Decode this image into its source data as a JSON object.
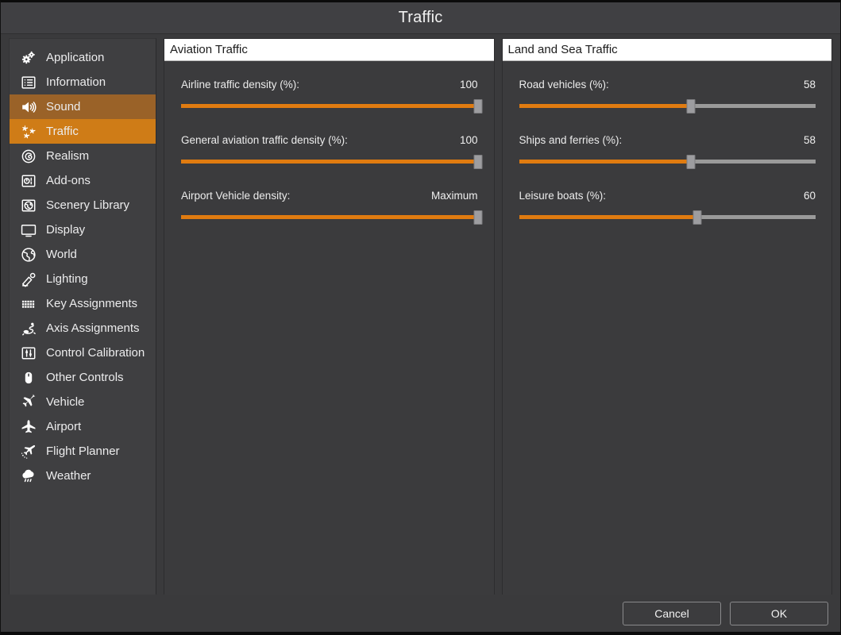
{
  "window": {
    "title": "Traffic"
  },
  "sidebar": {
    "items": [
      {
        "label": "Application",
        "icon": "gears-icon",
        "state": "normal"
      },
      {
        "label": "Information",
        "icon": "list-document-icon",
        "state": "normal"
      },
      {
        "label": "Sound",
        "icon": "speaker-icon",
        "state": "hovered"
      },
      {
        "label": "Traffic",
        "icon": "multiple-aircraft-icon",
        "state": "selected"
      },
      {
        "label": "Realism",
        "icon": "spiral-circle-icon",
        "state": "normal"
      },
      {
        "label": "Add-ons",
        "icon": "plugin-box-icon",
        "state": "normal"
      },
      {
        "label": "Scenery Library",
        "icon": "globe-square-icon",
        "state": "normal"
      },
      {
        "label": "Display",
        "icon": "monitor-icon",
        "state": "normal"
      },
      {
        "label": "World",
        "icon": "globe-icon",
        "state": "normal"
      },
      {
        "label": "Lighting",
        "icon": "lamp-icon",
        "state": "normal"
      },
      {
        "label": "Key Assignments",
        "icon": "keyboard-grid-icon",
        "state": "normal"
      },
      {
        "label": "Axis Assignments",
        "icon": "joystick-icon",
        "state": "normal"
      },
      {
        "label": "Control Calibration",
        "icon": "sliders-box-icon",
        "state": "normal"
      },
      {
        "label": "Other Controls",
        "icon": "mouse-icon",
        "state": "normal"
      },
      {
        "label": "Vehicle",
        "icon": "airplane-banking-icon",
        "state": "normal"
      },
      {
        "label": "Airport",
        "icon": "airplane-top-icon",
        "state": "normal"
      },
      {
        "label": "Flight Planner",
        "icon": "flight-path-icon",
        "state": "normal"
      },
      {
        "label": "Weather",
        "icon": "rain-cloud-icon",
        "state": "normal"
      }
    ]
  },
  "panels": [
    {
      "title": "Aviation Traffic",
      "sliders": [
        {
          "label": "Airline traffic density (%):",
          "value": "100",
          "percent": 100
        },
        {
          "label": "General aviation traffic density (%):",
          "value": "100",
          "percent": 100
        },
        {
          "label": "Airport Vehicle density:",
          "value": "Maximum",
          "percent": 100
        }
      ]
    },
    {
      "title": "Land and Sea Traffic",
      "sliders": [
        {
          "label": "Road vehicles (%):",
          "value": "58",
          "percent": 58
        },
        {
          "label": "Ships and ferries (%):",
          "value": "58",
          "percent": 58
        },
        {
          "label": "Leisure boats (%):",
          "value": "60",
          "percent": 60
        }
      ]
    }
  ],
  "footer": {
    "cancel_label": "Cancel",
    "ok_label": "OK"
  },
  "colors": {
    "accent_orange": "#e07b10",
    "selected_row": "#cf7c17",
    "hovered_row": "#9a6228",
    "track_gray": "#9a9a9a",
    "panel_bg": "#3b3b3d",
    "window_bg": "#3a3a3c"
  }
}
